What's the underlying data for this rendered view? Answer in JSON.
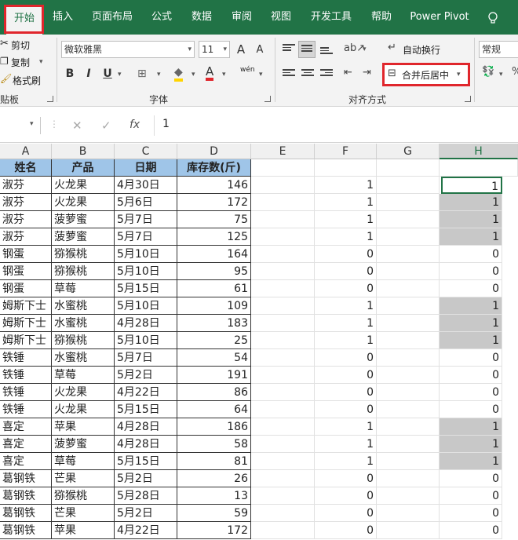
{
  "tabs": [
    "开始",
    "插入",
    "页面布局",
    "公式",
    "数据",
    "审阅",
    "视图",
    "开发工具",
    "帮助",
    "Power Pivot"
  ],
  "clipboard": {
    "cut": "剪切",
    "copy": "复制",
    "painter": "格式刷",
    "label": "贴板"
  },
  "font": {
    "name": "微软雅黑",
    "size": "11",
    "grow": "A",
    "shrink": "A",
    "bold": "B",
    "italic": "I",
    "underline": "U",
    "fill": "◆",
    "color": "A",
    "phonetic": "wén",
    "label": "字体"
  },
  "alignment": {
    "wrap": "自动换行",
    "merge": "合并后居中",
    "label": "对齐方式"
  },
  "number": {
    "format": "常规"
  },
  "formula_bar": {
    "cancel": "✕",
    "enter": "✓",
    "fx": "fx",
    "value": "1"
  },
  "columns": [
    "A",
    "B",
    "C",
    "D",
    "E",
    "F",
    "G",
    "H"
  ],
  "header_row": [
    "姓名",
    "产品",
    "日期",
    "库存数(斤)"
  ],
  "rows": [
    {
      "a": "淑芬",
      "b": "火龙果",
      "c": "4月30日",
      "d": "146",
      "f": "1",
      "h": "1",
      "shaded": false,
      "active": true
    },
    {
      "a": "淑芬",
      "b": "火龙果",
      "c": "5月6日",
      "d": "172",
      "f": "1",
      "h": "1",
      "shaded": true
    },
    {
      "a": "淑芬",
      "b": "菠萝蜜",
      "c": "5月7日",
      "d": "75",
      "f": "1",
      "h": "1",
      "shaded": true
    },
    {
      "a": "淑芬",
      "b": "菠萝蜜",
      "c": "5月7日",
      "d": "125",
      "f": "1",
      "h": "1",
      "shaded": true
    },
    {
      "a": "钢蛋",
      "b": "猕猴桃",
      "c": "5月10日",
      "d": "164",
      "f": "0",
      "h": "0",
      "shaded": false
    },
    {
      "a": "钢蛋",
      "b": "猕猴桃",
      "c": "5月10日",
      "d": "95",
      "f": "0",
      "h": "0",
      "shaded": false
    },
    {
      "a": "钢蛋",
      "b": "草莓",
      "c": "5月15日",
      "d": "61",
      "f": "0",
      "h": "0",
      "shaded": false
    },
    {
      "a": "姆斯下士",
      "b": "水蜜桃",
      "c": "5月10日",
      "d": "109",
      "f": "1",
      "h": "1",
      "shaded": true
    },
    {
      "a": "姆斯下士",
      "b": "水蜜桃",
      "c": "4月28日",
      "d": "183",
      "f": "1",
      "h": "1",
      "shaded": true
    },
    {
      "a": "姆斯下士",
      "b": "猕猴桃",
      "c": "5月10日",
      "d": "25",
      "f": "1",
      "h": "1",
      "shaded": true
    },
    {
      "a": "铁锤",
      "b": "水蜜桃",
      "c": "5月7日",
      "d": "54",
      "f": "0",
      "h": "0",
      "shaded": false
    },
    {
      "a": "铁锤",
      "b": "草莓",
      "c": "5月2日",
      "d": "191",
      "f": "0",
      "h": "0",
      "shaded": false
    },
    {
      "a": "铁锤",
      "b": "火龙果",
      "c": "4月22日",
      "d": "86",
      "f": "0",
      "h": "0",
      "shaded": false
    },
    {
      "a": "铁锤",
      "b": "火龙果",
      "c": "5月15日",
      "d": "64",
      "f": "0",
      "h": "0",
      "shaded": false
    },
    {
      "a": "喜定",
      "b": "苹果",
      "c": "4月28日",
      "d": "186",
      "f": "1",
      "h": "1",
      "shaded": true
    },
    {
      "a": "喜定",
      "b": "菠萝蜜",
      "c": "4月28日",
      "d": "58",
      "f": "1",
      "h": "1",
      "shaded": true
    },
    {
      "a": "喜定",
      "b": "草莓",
      "c": "5月15日",
      "d": "81",
      "f": "1",
      "h": "1",
      "shaded": true
    },
    {
      "a": "葛钢铁",
      "b": "芒果",
      "c": "5月2日",
      "d": "26",
      "f": "0",
      "h": "0",
      "shaded": false
    },
    {
      "a": "葛钢铁",
      "b": "猕猴桃",
      "c": "5月28日",
      "d": "13",
      "f": "0",
      "h": "0",
      "shaded": false
    },
    {
      "a": "葛钢铁",
      "b": "芒果",
      "c": "5月2日",
      "d": "59",
      "f": "0",
      "h": "0",
      "shaded": false
    },
    {
      "a": "葛钢铁",
      "b": "苹果",
      "c": "4月22日",
      "d": "172",
      "f": "0",
      "h": "0",
      "shaded": false
    }
  ],
  "colors": {
    "excel_green": "#217346",
    "highlight_red": "#e0262c",
    "header_fill": "#9fc5e8",
    "shade": "#c8c8c8"
  }
}
